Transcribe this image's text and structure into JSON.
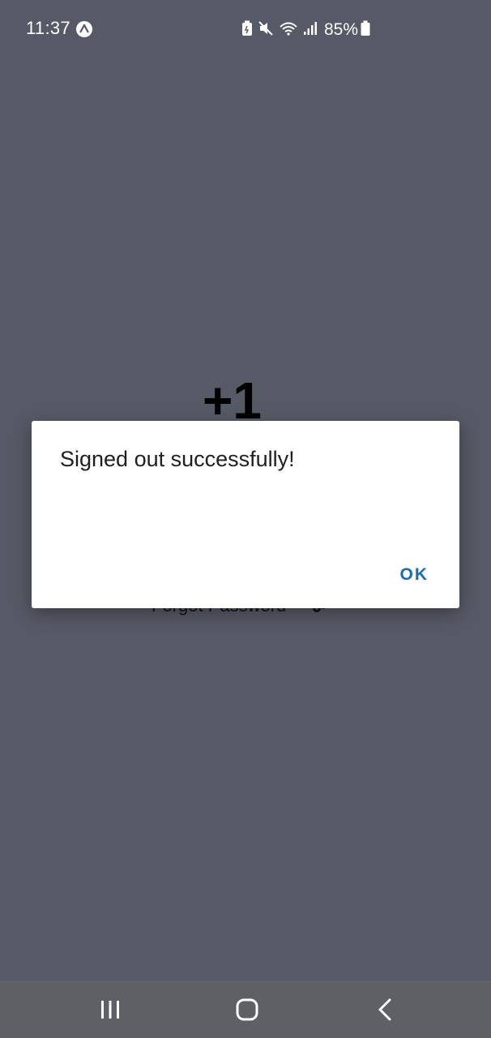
{
  "status_bar": {
    "time": "11:37",
    "battery_percent": "85%",
    "icons": [
      "app-notification-icon",
      "battery-saver-icon",
      "mute-icon",
      "wifi-icon",
      "signal-icon",
      "battery-icon"
    ]
  },
  "background": {
    "title": "+1",
    "forgot_password": "Forgot Password"
  },
  "dialog": {
    "message": "Signed out successfully!",
    "ok_label": "OK"
  },
  "nav_bar": {
    "buttons": [
      "recents",
      "home",
      "back"
    ]
  },
  "colors": {
    "scrim": "#565a66",
    "dialog_bg": "#ffffff",
    "accent": "#1a6fa8",
    "nav_bg": "#5f6066"
  }
}
